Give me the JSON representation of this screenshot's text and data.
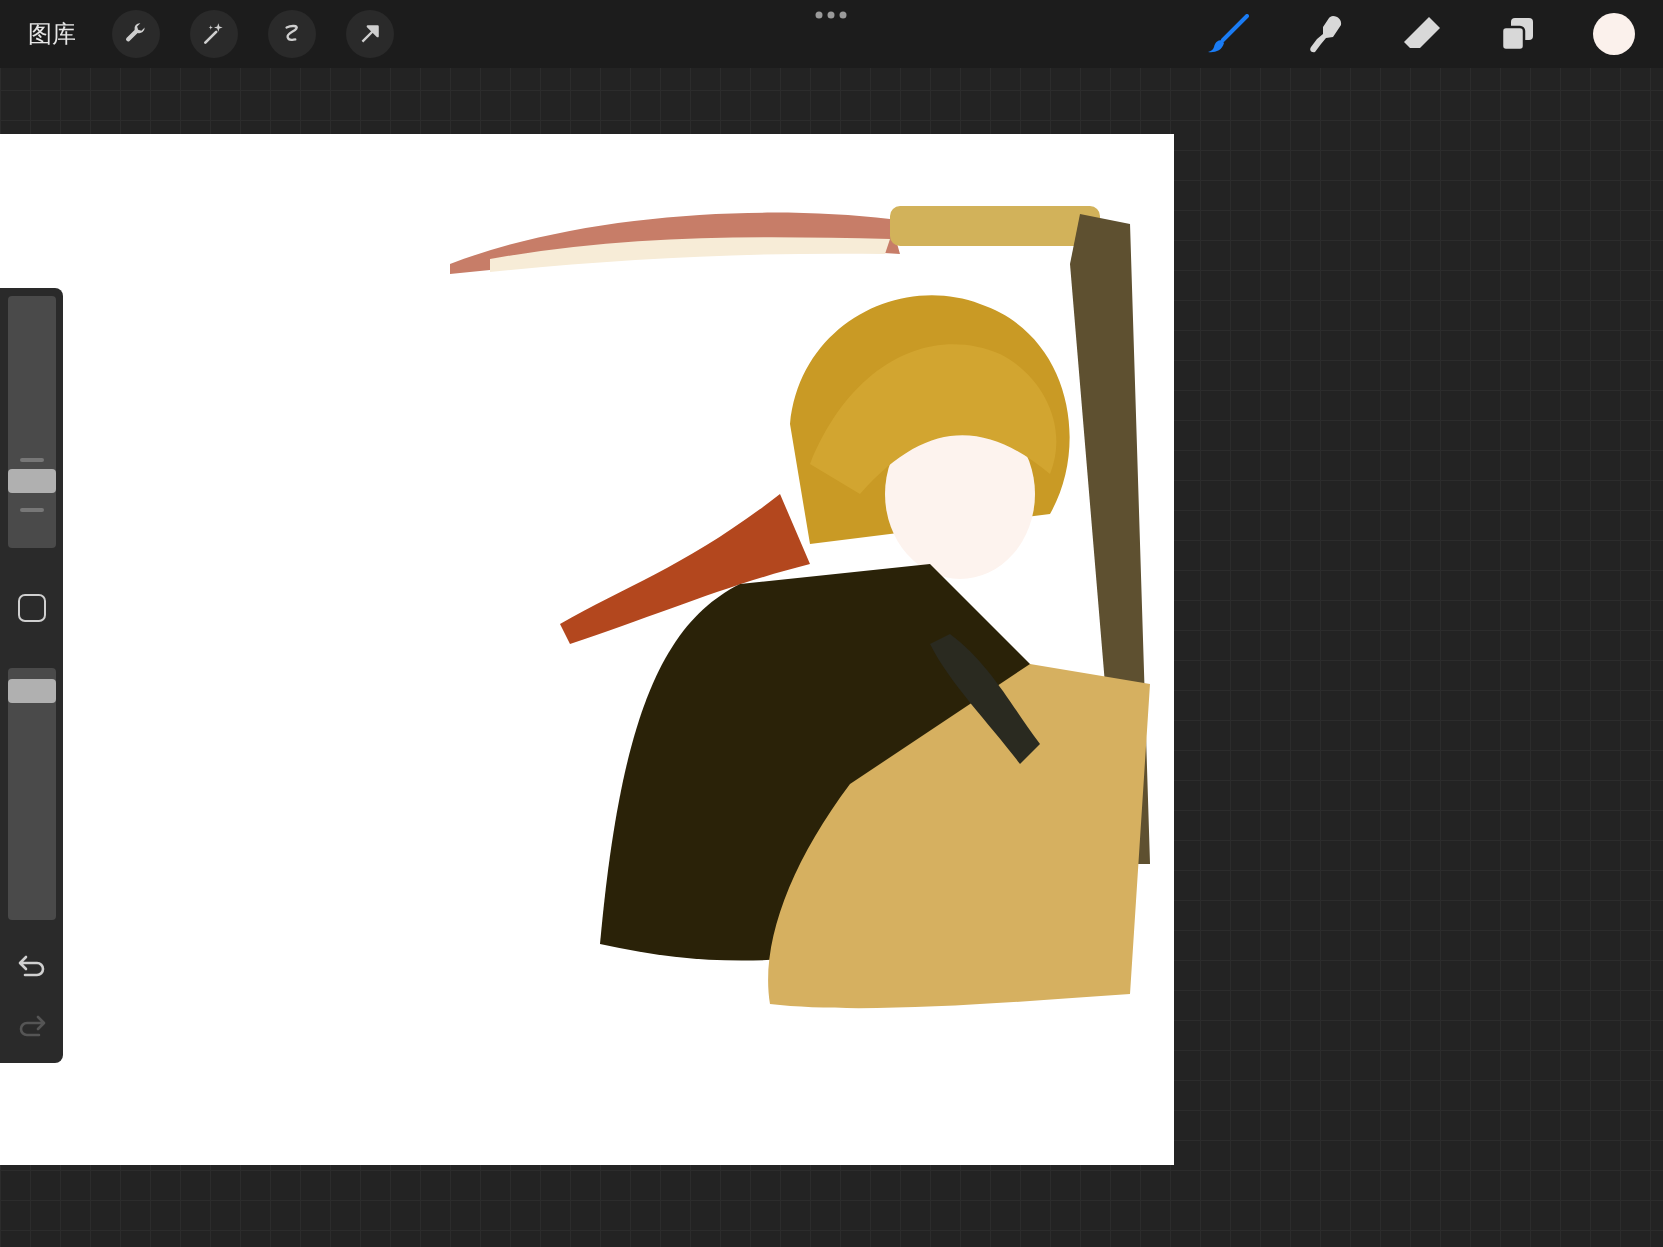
{
  "toolbar": {
    "gallery_label": "图库",
    "tools": [
      {
        "kind": "brush",
        "selected": true
      },
      {
        "kind": "smudge",
        "selected": false
      },
      {
        "kind": "eraser",
        "selected": false
      }
    ]
  },
  "sidebar": {
    "brush_size": {
      "level": 0.24
    },
    "opacity": {
      "level": 0.95
    }
  }
}
